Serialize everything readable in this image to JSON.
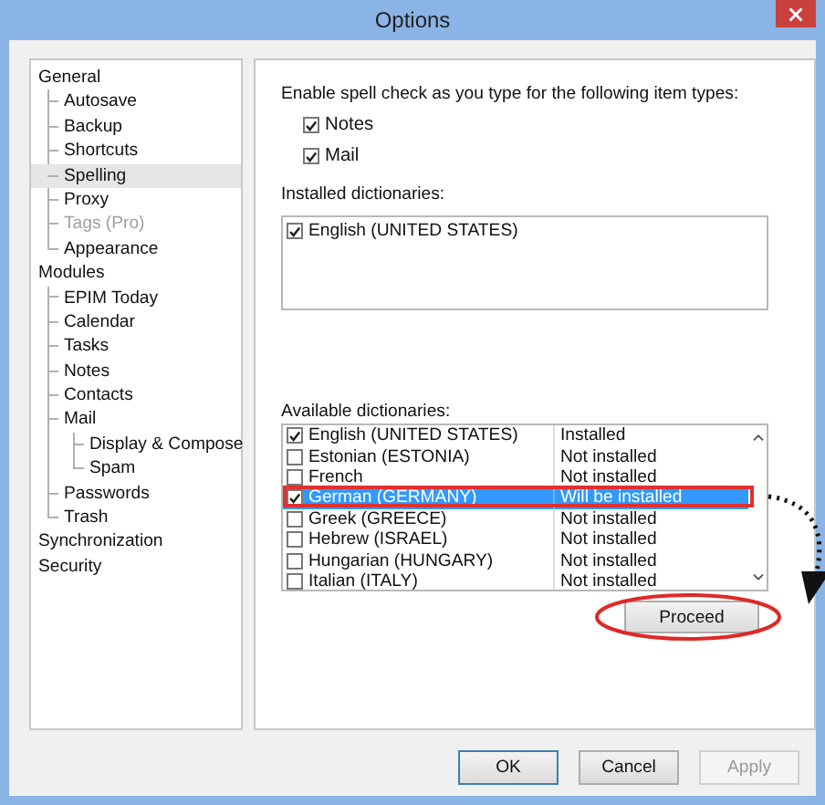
{
  "window": {
    "title": "Options"
  },
  "tree": [
    {
      "label": "General",
      "selected": false,
      "disabled": false,
      "children": [
        {
          "label": "Autosave",
          "selected": false,
          "disabled": false
        },
        {
          "label": "Backup",
          "selected": false,
          "disabled": false
        },
        {
          "label": "Shortcuts",
          "selected": false,
          "disabled": false
        },
        {
          "label": "Spelling",
          "selected": true,
          "disabled": false
        },
        {
          "label": "Proxy",
          "selected": false,
          "disabled": false
        },
        {
          "label": "Tags (Pro)",
          "selected": false,
          "disabled": true
        },
        {
          "label": "Appearance",
          "selected": false,
          "disabled": false
        }
      ]
    },
    {
      "label": "Modules",
      "selected": false,
      "disabled": false,
      "children": [
        {
          "label": "EPIM Today",
          "selected": false,
          "disabled": false
        },
        {
          "label": "Calendar",
          "selected": false,
          "disabled": false
        },
        {
          "label": "Tasks",
          "selected": false,
          "disabled": false
        },
        {
          "label": "Notes",
          "selected": false,
          "disabled": false
        },
        {
          "label": "Contacts",
          "selected": false,
          "disabled": false
        },
        {
          "label": "Mail",
          "selected": false,
          "disabled": false,
          "children": [
            {
              "label": "Display & Compose",
              "selected": false,
              "disabled": false
            },
            {
              "label": "Spam",
              "selected": false,
              "disabled": false
            }
          ]
        },
        {
          "label": "Passwords",
          "selected": false,
          "disabled": false
        },
        {
          "label": "Trash",
          "selected": false,
          "disabled": false
        }
      ]
    },
    {
      "label": "Synchronization",
      "selected": false,
      "disabled": false
    },
    {
      "label": "Security",
      "selected": false,
      "disabled": false
    }
  ],
  "spelling": {
    "heading": "Enable spell check as you type for the following item types:",
    "item_types": [
      {
        "label": "Notes",
        "checked": true
      },
      {
        "label": "Mail",
        "checked": true
      }
    ],
    "installed_label": "Installed dictionaries:",
    "installed": [
      {
        "name": "English (UNITED STATES)",
        "checked": true
      }
    ],
    "available_label": "Available dictionaries:",
    "available": [
      {
        "name": "English (UNITED STATES)",
        "status": "Installed",
        "checked": true,
        "selected": false
      },
      {
        "name": "Estonian (ESTONIA)",
        "status": "Not installed",
        "checked": false,
        "selected": false
      },
      {
        "name": "French",
        "status": "Not installed",
        "checked": false,
        "selected": false
      },
      {
        "name": "German (GERMANY)",
        "status": "Will be installed",
        "checked": true,
        "selected": true
      },
      {
        "name": "Greek (GREECE)",
        "status": "Not installed",
        "checked": false,
        "selected": false
      },
      {
        "name": "Hebrew (ISRAEL)",
        "status": "Not installed",
        "checked": false,
        "selected": false
      },
      {
        "name": "Hungarian (HUNGARY)",
        "status": "Not installed",
        "checked": false,
        "selected": false
      },
      {
        "name": "Italian (ITALY)",
        "status": "Not installed",
        "checked": false,
        "selected": false
      }
    ],
    "proceed_button": "Proceed"
  },
  "buttons": [
    {
      "label": "OK",
      "disabled": false,
      "default": true
    },
    {
      "label": "Cancel",
      "disabled": false,
      "default": false
    },
    {
      "label": "Apply",
      "disabled": true,
      "default": false
    }
  ]
}
